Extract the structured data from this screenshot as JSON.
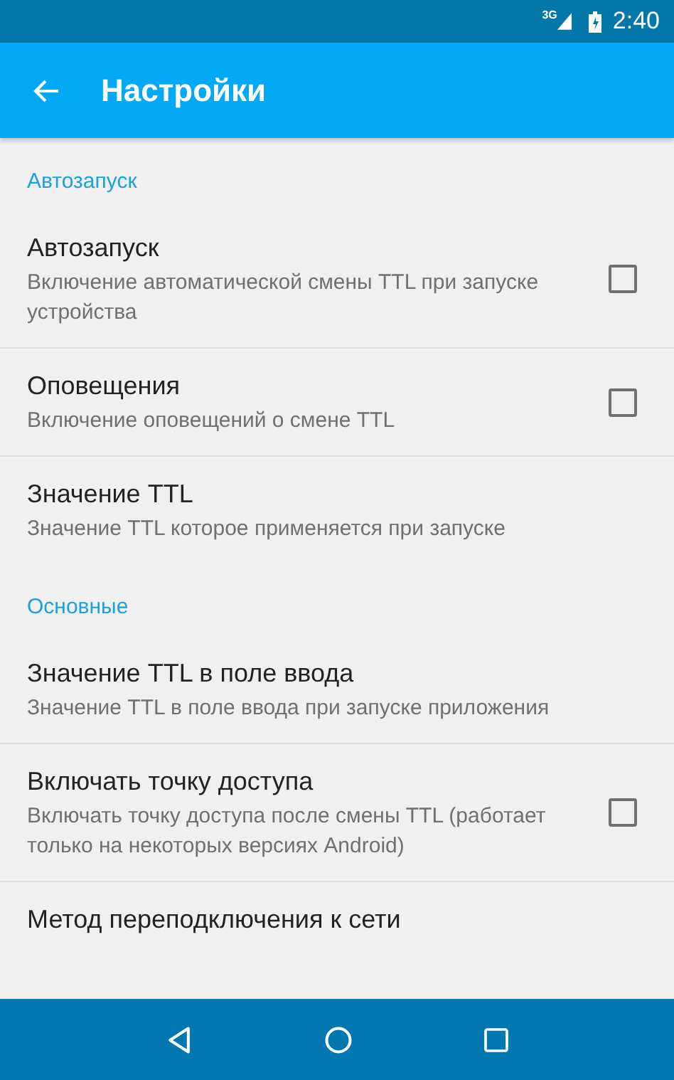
{
  "status_bar": {
    "network": "3G",
    "time": "2:40"
  },
  "app_bar": {
    "title": "Настройки"
  },
  "sections": [
    {
      "title": "Автозапуск",
      "items": [
        {
          "kind": "checkbox",
          "title": "Автозапуск",
          "summary": "Включение автоматической смены TTL при запуске устройства",
          "checked": false
        },
        {
          "kind": "checkbox",
          "title": "Оповещения",
          "summary": "Включение оповещений о смене TTL",
          "checked": false
        },
        {
          "kind": "text",
          "title": "Значение TTL",
          "summary": "Значение TTL которое применяется при запуске"
        }
      ]
    },
    {
      "title": "Основные",
      "items": [
        {
          "kind": "text",
          "title": "Значение TTL в поле ввода",
          "summary": "Значение TTL в поле ввода при запуске приложения"
        },
        {
          "kind": "checkbox",
          "title": "Включать точку доступа",
          "summary": "Включать точку доступа после смены TTL (работает только на некоторых версиях Android)",
          "checked": false
        },
        {
          "kind": "text",
          "title": "Метод переподключения к сети"
        }
      ]
    }
  ]
}
